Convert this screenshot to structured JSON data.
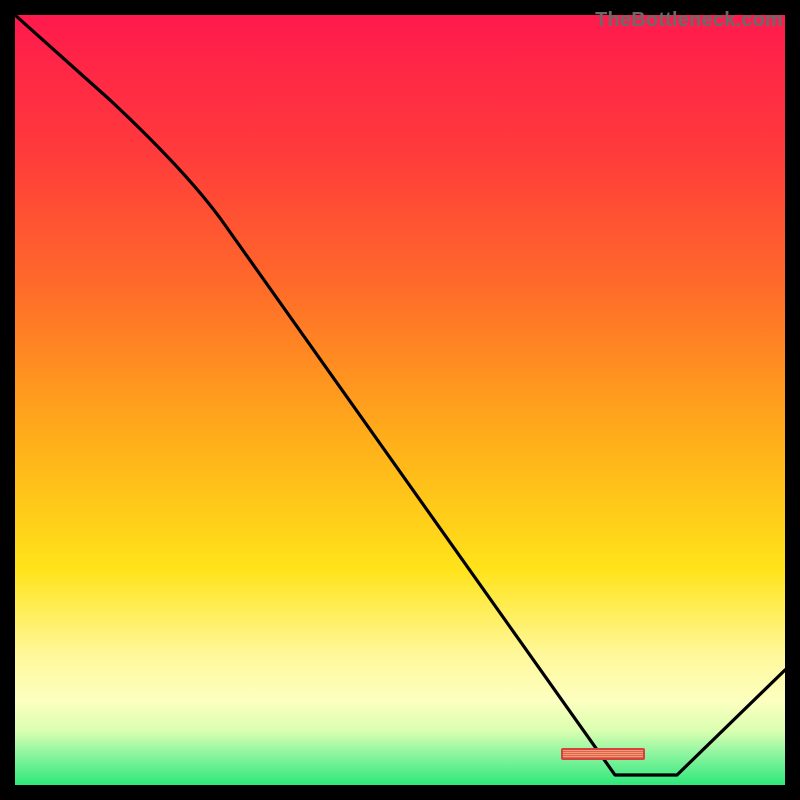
{
  "attribution": "TheBottleneck.com",
  "chart_data": {
    "type": "line",
    "title": "",
    "xlabel": "",
    "ylabel": "",
    "xlim": [
      0,
      100
    ],
    "ylim": [
      0,
      100
    ],
    "x": [
      0,
      25,
      78,
      86,
      100
    ],
    "values": [
      100,
      77,
      1,
      1,
      15
    ],
    "note": "Background is a vertical gradient from red (high y) through orange/yellow to green (low y); a short red/orange horizontal marker sits at the curve minimum near x≈78–86."
  }
}
